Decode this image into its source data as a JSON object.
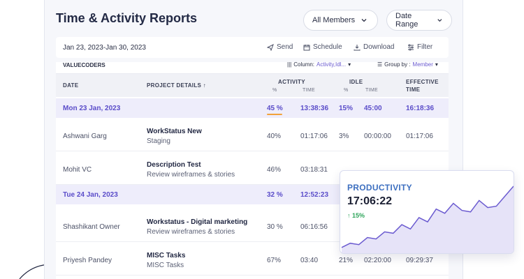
{
  "header": {
    "title": "Time & Activity Reports",
    "members_label": "All Members",
    "range_label": "Date Range"
  },
  "toolbar": {
    "date_range": "Jan 23, 2023-Jan 30, 2023",
    "send": "Send",
    "schedule": "Schedule",
    "download": "Download",
    "filter": "Filter"
  },
  "table": {
    "org": "VALUECODERS",
    "column_label": "Column:",
    "column_value": "Activity,Idl...",
    "groupby_label": "Group by :",
    "groupby_value": "Member",
    "headers": {
      "date": "DATE",
      "project": "PROJECT DETAILS ↑",
      "activity": "ACTIVITY",
      "idle": "IDLE",
      "effective": "EFFECTIVE",
      "effective2": "TIME",
      "pct": "%",
      "time": "TIME",
      "pct2": "%",
      "time2": "TIME"
    },
    "rows": [
      {
        "date": "Mon 23 Jan, 2023",
        "activity_pct": "45 %",
        "activity_time": "13:38:36",
        "idle_pct": "15%",
        "idle_time": "45:00",
        "effective": "16:18:36"
      },
      {
        "date": "Ashwani Garg",
        "project": "WorkStatus New",
        "sub": "Staging",
        "activity_pct": "40%",
        "activity_time": "01:17:06",
        "idle_pct": "3%",
        "idle_time": "00:00:00",
        "effective": "01:17:06"
      },
      {
        "date": "Mohit VC",
        "project": "Description Test",
        "sub": "Review wireframes & stories",
        "activity_pct": "46%",
        "activity_time": "03:18:31",
        "idle_pct": "",
        "idle_time": "",
        "effective": ""
      },
      {
        "date": "Tue 24 Jan, 2023",
        "activity_pct": "32 %",
        "activity_time": "12:52:23",
        "idle_pct": "",
        "idle_time": "",
        "effective": ""
      },
      {
        "date": "Shashikant Owner",
        "project": "Workstatus - Digital marketing",
        "sub": "Review wireframes & stories",
        "activity_pct": "30 %",
        "activity_time": "06:16:56",
        "idle_pct": "",
        "idle_time": "",
        "effective": ""
      },
      {
        "date": "Priyesh Pandey",
        "project": "MISC Tasks",
        "sub": "MISC Tasks",
        "activity_pct": "67%",
        "activity_time": "03:40",
        "idle_pct": "21%",
        "idle_time": "02:20:00",
        "effective": "09:29:37"
      }
    ]
  },
  "productivity": {
    "title": "PRODUCTIVITY",
    "time": "17:06:22",
    "delta": "↑ 15%",
    "accent": "#6b5bd0",
    "fill": "#e6e3f8",
    "trend": [
      8,
      14,
      12,
      22,
      20,
      30,
      28,
      40,
      34,
      50,
      44,
      62,
      56,
      70,
      60,
      58,
      74,
      64,
      66,
      80,
      94
    ]
  }
}
